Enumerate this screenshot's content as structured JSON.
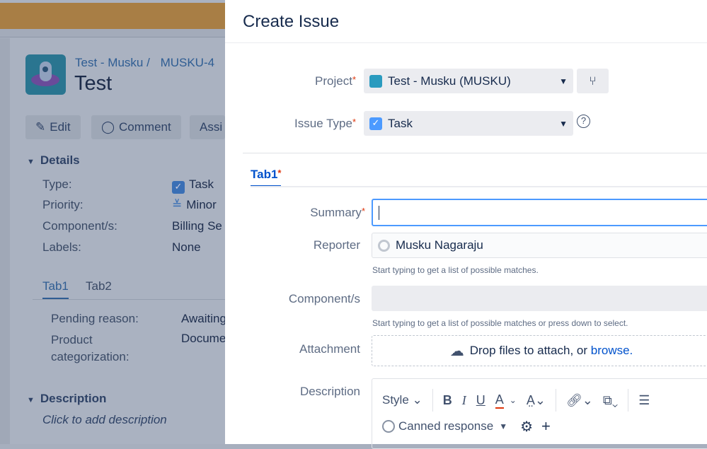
{
  "background_issue": {
    "breadcrumb_project": "Test - Musku",
    "breadcrumb_sep": "/",
    "breadcrumb_issue": "MUSKU-4",
    "title": "Test",
    "buttons": {
      "edit": "Edit",
      "comment": "Comment",
      "assign": "Assi"
    },
    "details_heading": "Details",
    "fields": [
      {
        "label": "Type:",
        "value": "Task"
      },
      {
        "label": "Priority:",
        "value": "Minor"
      },
      {
        "label": "Component/s:",
        "value": "Billing Se"
      },
      {
        "label": "Labels:",
        "value": "None"
      }
    ],
    "tabs": [
      "Tab1",
      "Tab2"
    ],
    "tab_fields": [
      {
        "label": "Pending reason:",
        "value": "Awaiting"
      },
      {
        "label": "Product categorization:",
        "value": "Docume"
      }
    ],
    "description_heading": "Description",
    "description_placeholder": "Click to add description"
  },
  "modal": {
    "title": "Create Issue",
    "project_label": "Project",
    "project_value": "Test - Musku (MUSKU)",
    "issue_type_label": "Issue Type",
    "issue_type_value": "Task",
    "tab": "Tab1",
    "summary_label": "Summary",
    "summary_value": "",
    "reporter_label": "Reporter",
    "reporter_value": "Musku Nagaraju",
    "reporter_help": "Start typing to get a list of possible matches.",
    "components_label": "Component/s",
    "components_help": "Start typing to get a list of possible matches or press down to select.",
    "attachment_label": "Attachment",
    "attachment_text": "Drop files to attach, or",
    "attachment_browse": "browse.",
    "description_label": "Description",
    "toolbar": {
      "style": "Style",
      "bold": "B",
      "italic": "I",
      "underline": "U",
      "color": "A",
      "canned": "Canned response"
    },
    "required_mark": "*"
  }
}
